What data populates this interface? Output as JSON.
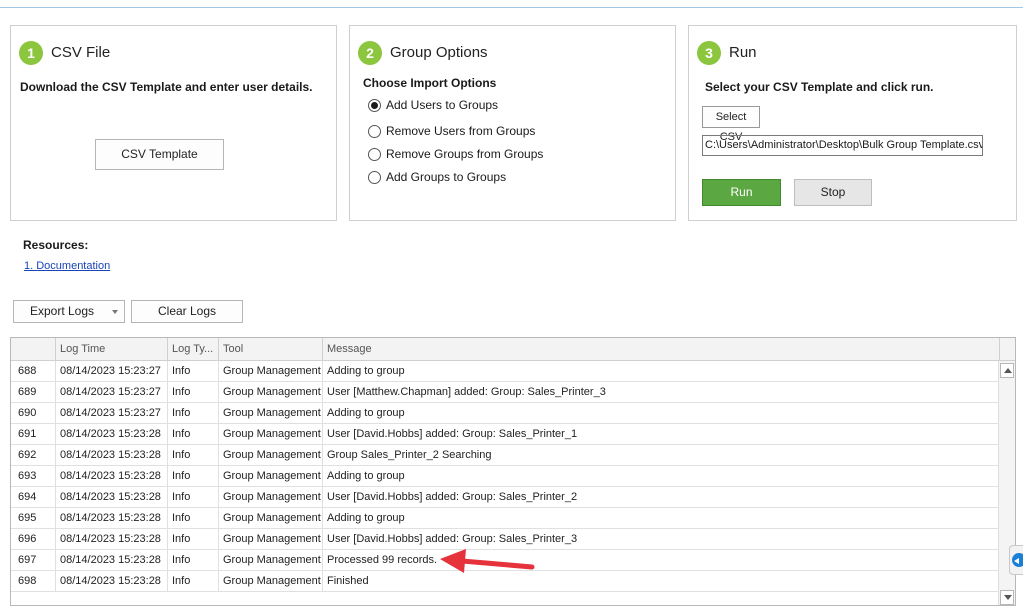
{
  "panels": {
    "csv_file": {
      "step": "1",
      "title": "CSV File",
      "description": "Download the CSV Template and enter user details.",
      "template_button": "CSV Template"
    },
    "group_options": {
      "step": "2",
      "title": "Group Options",
      "heading": "Choose Import Options",
      "options": [
        {
          "label": "Add Users to Groups",
          "selected": true
        },
        {
          "label": "Remove Users from Groups",
          "selected": false
        },
        {
          "label": "Remove Groups from Groups",
          "selected": false
        },
        {
          "label": "Add Groups to Groups",
          "selected": false
        }
      ]
    },
    "run": {
      "step": "3",
      "title": "Run",
      "description": "Select your CSV Template and click run.",
      "select_button": "Select CSV",
      "csv_path": "C:\\Users\\Administrator\\Desktop\\Bulk Group Template.csv",
      "run_button": "Run",
      "stop_button": "Stop"
    }
  },
  "resources": {
    "label": "Resources:",
    "links": [
      "1. Documentation"
    ]
  },
  "log_toolbar": {
    "export_button": "Export Logs",
    "clear_button": "Clear Logs"
  },
  "log_grid": {
    "columns": [
      "",
      "Log Time",
      "Log Ty...",
      "Tool",
      "Message"
    ],
    "rows": [
      {
        "id": "688",
        "time": "08/14/2023 15:23:27",
        "type": "Info",
        "tool": "Group Management",
        "message": "Adding to group"
      },
      {
        "id": "689",
        "time": "08/14/2023 15:23:27",
        "type": "Info",
        "tool": "Group Management",
        "message": "User [Matthew.Chapman] added: Group: Sales_Printer_3"
      },
      {
        "id": "690",
        "time": "08/14/2023 15:23:27",
        "type": "Info",
        "tool": "Group Management",
        "message": "Adding to group"
      },
      {
        "id": "691",
        "time": "08/14/2023 15:23:28",
        "type": "Info",
        "tool": "Group Management",
        "message": "User [David.Hobbs] added: Group: Sales_Printer_1"
      },
      {
        "id": "692",
        "time": "08/14/2023 15:23:28",
        "type": "Info",
        "tool": "Group Management",
        "message": "Group  Sales_Printer_2 Searching"
      },
      {
        "id": "693",
        "time": "08/14/2023 15:23:28",
        "type": "Info",
        "tool": "Group Management",
        "message": "Adding to group"
      },
      {
        "id": "694",
        "time": "08/14/2023 15:23:28",
        "type": "Info",
        "tool": "Group Management",
        "message": "User [David.Hobbs] added: Group:  Sales_Printer_2"
      },
      {
        "id": "695",
        "time": "08/14/2023 15:23:28",
        "type": "Info",
        "tool": "Group Management",
        "message": "Adding to group"
      },
      {
        "id": "696",
        "time": "08/14/2023 15:23:28",
        "type": "Info",
        "tool": "Group Management",
        "message": "User [David.Hobbs] added: Group: Sales_Printer_3"
      },
      {
        "id": "697",
        "time": "08/14/2023 15:23:28",
        "type": "Info",
        "tool": "Group Management",
        "message": "Processed 99 records."
      },
      {
        "id": "698",
        "time": "08/14/2023 15:23:28",
        "type": "Info",
        "tool": "Group Management",
        "message": "Finished"
      }
    ]
  },
  "colors": {
    "step_badge": "#8cc63e",
    "run_button": "#5ba843",
    "callout_arrow": "#e5323b",
    "link": "#1a44b8"
  },
  "icons": {
    "callout": "red-arrow-icon",
    "side_tab": "collapse-arrow-icon",
    "scroll_up": "chevron-up-icon",
    "scroll_down": "chevron-down-icon",
    "dropdown": "caret-down-icon"
  }
}
